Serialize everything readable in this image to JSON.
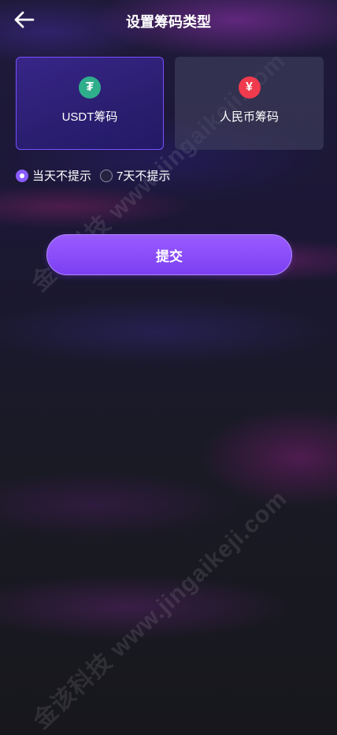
{
  "header": {
    "title": "设置筹码类型",
    "back_icon": "arrow-left-icon"
  },
  "chip_types": [
    {
      "label": "USDT筹码",
      "icon": "usdt-coin-icon",
      "icon_glyph": "₮",
      "color": "#2fae8b",
      "selected": true
    },
    {
      "label": "人民币筹码",
      "icon": "rmb-coin-icon",
      "icon_glyph": "¥",
      "color": "#ef3b4d",
      "selected": false
    }
  ],
  "reminder_options": [
    {
      "label": "当天不提示",
      "selected": true
    },
    {
      "label": "7天不提示",
      "selected": false
    }
  ],
  "submit_label": "提交",
  "watermark": "金该科技 www.jingaikeji.com",
  "colors": {
    "accent": "#8a5cff",
    "usdt": "#2fae8b",
    "rmb": "#ef3b4d"
  }
}
